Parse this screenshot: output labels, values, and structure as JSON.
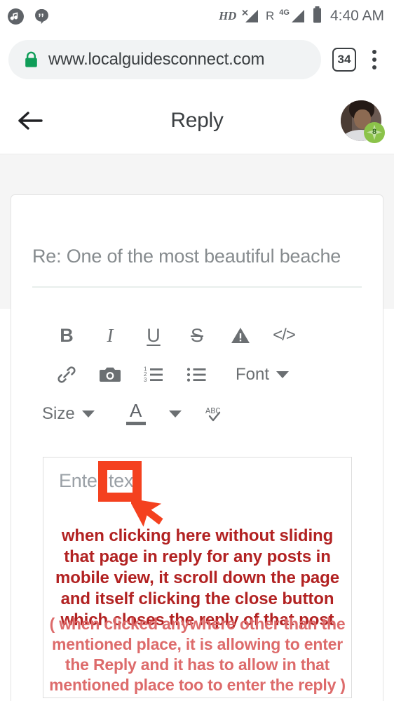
{
  "status_bar": {
    "notifications": [
      "music-note-icon",
      "hangouts-icon"
    ],
    "hd_label": "HD",
    "roaming_label": "R",
    "network_label": "4G",
    "no_sim_icon": "signal-no-sim-icon",
    "battery_icon": "battery-icon",
    "time": "4:40 AM"
  },
  "browser": {
    "lock_icon": "lock-icon",
    "url": "www.localguidesconnect.com",
    "tab_count": "34",
    "menu_icon": "kebab-menu-icon",
    "lock_color": "#0f9d58"
  },
  "header": {
    "back_icon": "back-arrow-icon",
    "title": "Reply",
    "avatar": "user-avatar",
    "level_badge": "8",
    "badge_color": "#8bc34a"
  },
  "compose": {
    "subject_placeholder": "Re: One of the most beautiful beache",
    "toolbar": {
      "row1": [
        {
          "name": "bold-icon",
          "label": "B"
        },
        {
          "name": "italic-icon",
          "label": "I"
        },
        {
          "name": "underline-icon",
          "label": "U"
        },
        {
          "name": "strikethrough-icon",
          "label": "S"
        },
        {
          "name": "spoiler-warning-icon",
          "label": ""
        },
        {
          "name": "code-icon",
          "label": "</>"
        }
      ],
      "row2": [
        {
          "name": "link-icon",
          "label": ""
        },
        {
          "name": "camera-icon",
          "label": ""
        },
        {
          "name": "numbered-list-icon",
          "label": ""
        },
        {
          "name": "bullet-list-icon",
          "label": ""
        }
      ],
      "font_label": "Font",
      "size_label": "Size",
      "text_color_icon": "text-color-icon",
      "text_color_letter": "A",
      "spellcheck_icon": "spellcheck-icon",
      "spellcheck_label": "ABC"
    },
    "editor_placeholder": "Enter text"
  },
  "annotations": {
    "highlight_box": "red-highlight-square",
    "cursor": "mouse-cursor-arrow",
    "highlight_color": "#f4411f",
    "note_primary": "when clicking here without sliding that page in reply for any posts in mobile view, it scroll down the page and itself clicking the close button which closes the reply of that post",
    "note_primary_color": "#b22222",
    "note_secondary": "( when clicked anywhere other than the mentioned place, it is allowing to enter the Reply and it has to allow in that mentioned place too to enter the reply )",
    "note_secondary_color": "#dd6b6b"
  }
}
